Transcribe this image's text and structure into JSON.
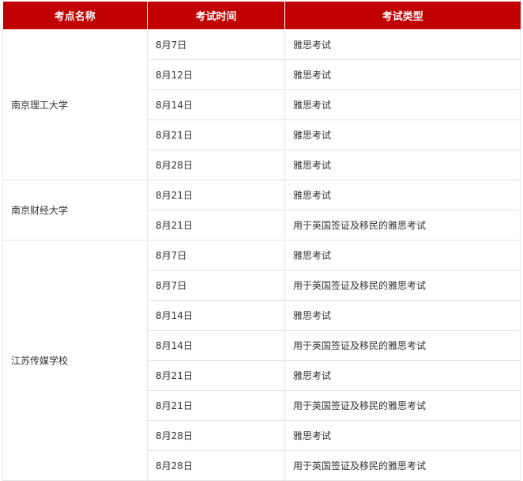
{
  "table": {
    "headers": [
      "考点名称",
      "考试时间",
      "考试类型"
    ],
    "groups": [
      {
        "venue": "南京理工大学",
        "rows": [
          {
            "date": "8月7日",
            "type": "雅思考试"
          },
          {
            "date": "8月12日",
            "type": "雅思考试"
          },
          {
            "date": "8月14日",
            "type": "雅思考试"
          },
          {
            "date": "8月21日",
            "type": "雅思考试"
          },
          {
            "date": "8月28日",
            "type": "雅思考试"
          }
        ]
      },
      {
        "venue": "南京财经大学",
        "rows": [
          {
            "date": "8月21日",
            "type": "雅思考试"
          },
          {
            "date": "8月21日",
            "type": "用于英国签证及移民的雅思考试"
          }
        ]
      },
      {
        "venue": "江苏传媒学校",
        "rows": [
          {
            "date": "8月7日",
            "type": "雅思考试"
          },
          {
            "date": "8月7日",
            "type": "用于英国签证及移民的雅思考试"
          },
          {
            "date": "8月14日",
            "type": "雅思考试"
          },
          {
            "date": "8月14日",
            "type": "用于英国签证及移民的雅思考试"
          },
          {
            "date": "8月21日",
            "type": "雅思考试"
          },
          {
            "date": "8月21日",
            "type": "用于英国签证及移民的雅思考试"
          },
          {
            "date": "8月28日",
            "type": "雅思考试"
          },
          {
            "date": "8月28日",
            "type": "用于英国签证及移民的雅思考试"
          }
        ]
      }
    ]
  },
  "colors": {
    "header_bg": "#c00000",
    "header_text": "#ffffff",
    "border": "#e4e4e4",
    "body_text": "#333333"
  }
}
